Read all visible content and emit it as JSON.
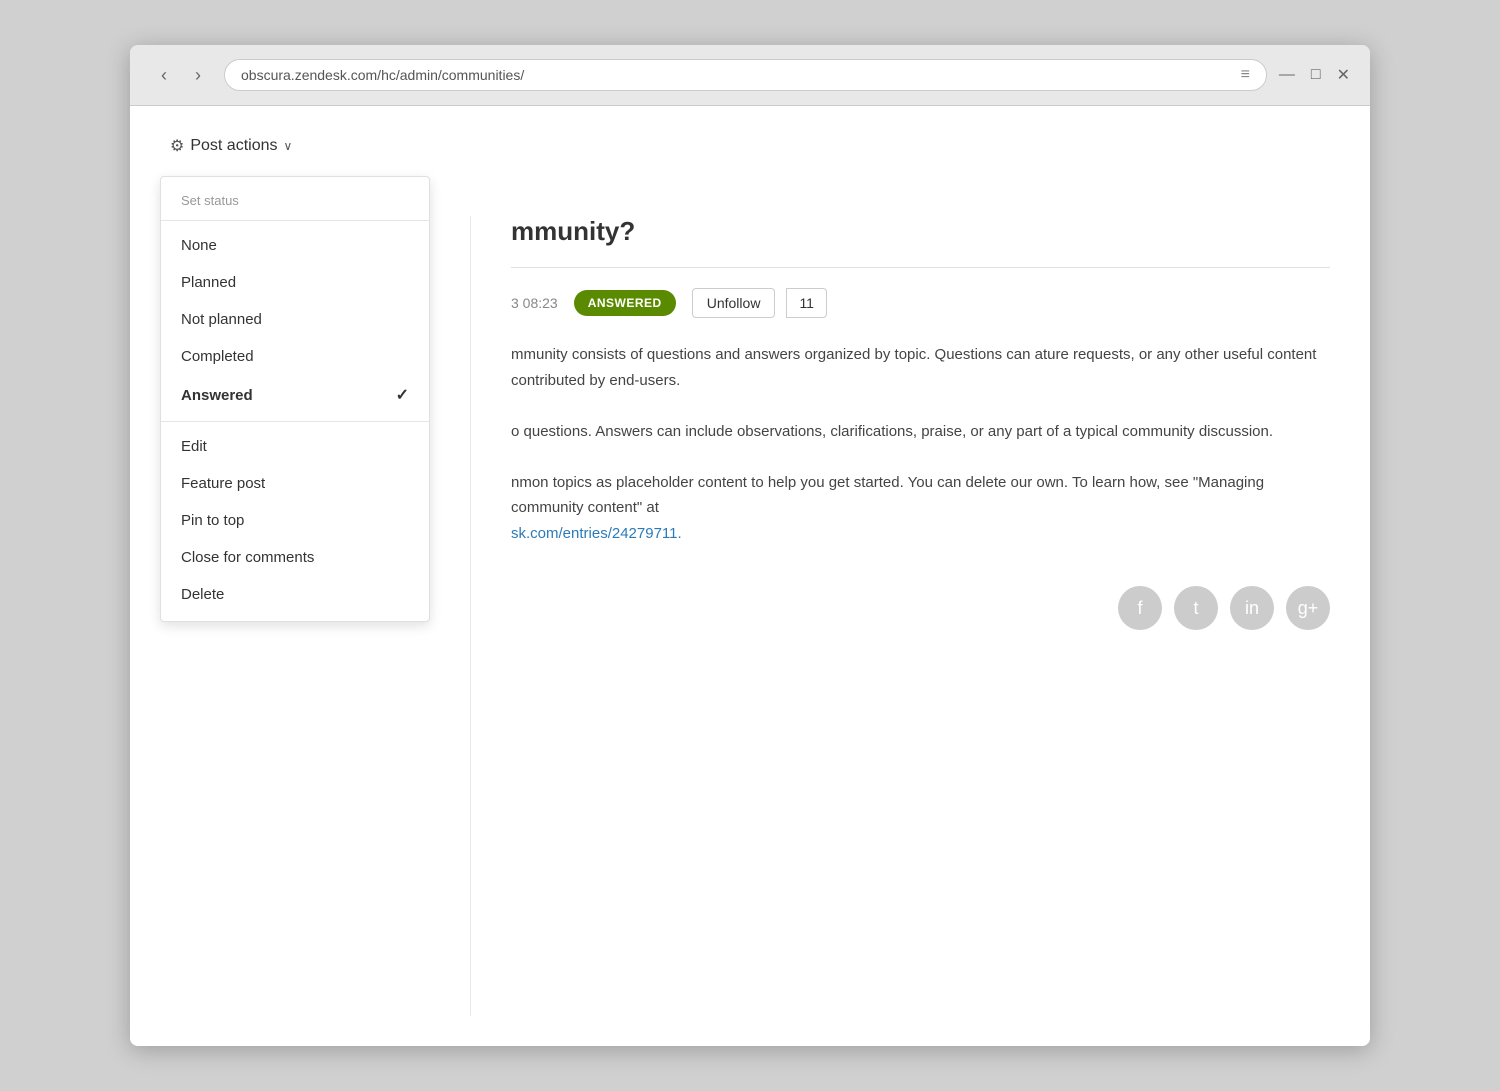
{
  "browser": {
    "url": "obscura.zendesk.com/hc/admin/communities/",
    "back_label": "‹",
    "forward_label": "›",
    "hamburger": "≡",
    "minimize": "—",
    "maximize": "□",
    "close": "✕"
  },
  "post_actions": {
    "trigger_label": "Post actions",
    "chevron": "∨",
    "dropdown": {
      "set_status_label": "Set status",
      "items_status": [
        {
          "id": "none",
          "label": "None",
          "active": false
        },
        {
          "id": "planned",
          "label": "Planned",
          "active": false
        },
        {
          "id": "not-planned",
          "label": "Not planned",
          "active": false
        },
        {
          "id": "completed",
          "label": "Completed",
          "active": false
        },
        {
          "id": "answered",
          "label": "Answered",
          "active": true
        }
      ],
      "items_actions": [
        {
          "id": "edit",
          "label": "Edit",
          "active": false
        },
        {
          "id": "feature-post",
          "label": "Feature post",
          "active": false
        },
        {
          "id": "pin-to-top",
          "label": "Pin to top",
          "active": false
        },
        {
          "id": "close-for-comments",
          "label": "Close for comments",
          "active": false
        },
        {
          "id": "delete",
          "label": "Delete",
          "active": false
        }
      ]
    }
  },
  "post": {
    "title": "mmunity?",
    "date": "3 08:23",
    "badge": "ANSWERED",
    "unfollow_label": "Unfollow",
    "follower_count": "11",
    "body_1": "mmunity consists of questions and answers organized by topic. Questions can ature requests, or any other useful content contributed by end-users.",
    "body_2": "o questions. Answers can include observations, clarifications, praise, or any part of a typical community discussion.",
    "body_3": "nmon topics as placeholder content to help you get started. You can delete our own. To learn how, see \"Managing community content\" at",
    "link_text": "sk.com/entries/24279711.",
    "link_href": "#"
  },
  "social": {
    "facebook_icon": "f",
    "twitter_icon": "t",
    "linkedin_icon": "in",
    "gplus_icon": "g+"
  }
}
